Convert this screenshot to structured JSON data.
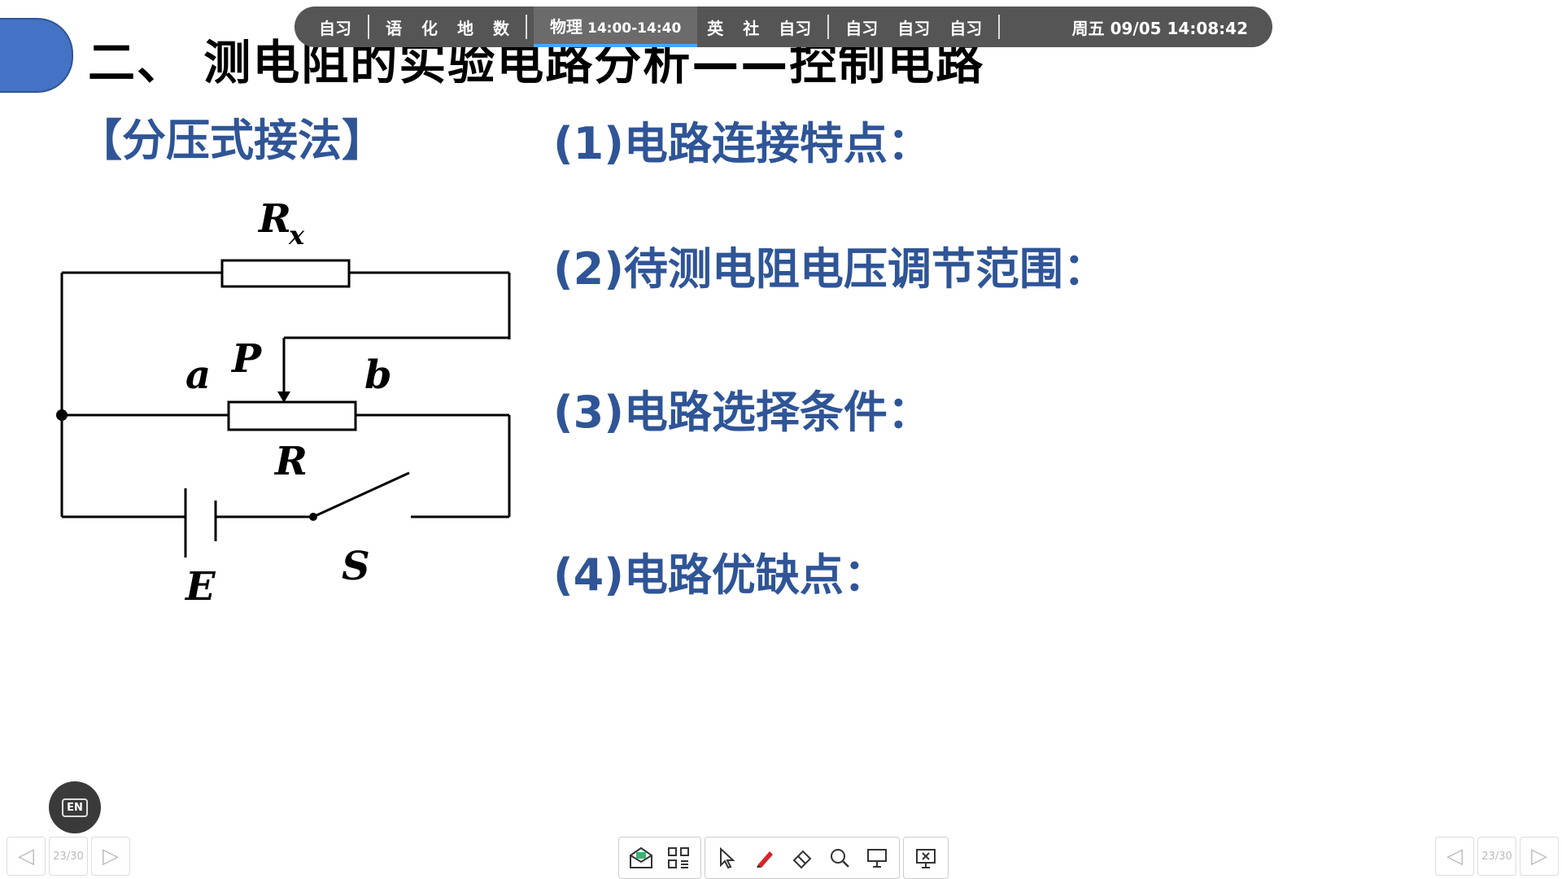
{
  "slide": {
    "title": "二、 测电阻的实验电路分析——控制电路",
    "method_label": "【分压式接法】",
    "points": [
      "(1)电路连接特点：",
      "(2)待测电阻电压调节范围：",
      "(3)电路选择条件：",
      "(4)电路优缺点："
    ],
    "circuit": {
      "rx_label": "R",
      "rx_sub": "x",
      "r_label": "R",
      "a_label": "a",
      "b_label": "b",
      "p_label": "P",
      "e_label": "E",
      "s_label": "S"
    }
  },
  "schedule": {
    "items": [
      {
        "label": "自习"
      },
      {
        "label": "语"
      },
      {
        "label": "化"
      },
      {
        "label": "地"
      },
      {
        "label": "数"
      }
    ],
    "current": {
      "label": "物理",
      "time": "14:00-14:40"
    },
    "items2": [
      {
        "label": "英"
      },
      {
        "label": "社"
      },
      {
        "label": "自习"
      }
    ],
    "items3": [
      {
        "label": "自习"
      },
      {
        "label": "自习"
      },
      {
        "label": "自习"
      }
    ],
    "clock": "周五 09/05  14:08:42"
  },
  "controls": {
    "en_label": "EN",
    "page_indicator": "23/30",
    "icons": {
      "left_prev": "chevron-left-icon",
      "left_next": "chevron-right-icon",
      "tools": [
        "envelope-icon",
        "grid-icon",
        "pointer-icon",
        "pen-icon",
        "eraser-icon",
        "magnifier-icon",
        "screen-icon",
        "exit-presentation-icon"
      ]
    },
    "colors": {
      "accent": "#4472c4",
      "text_blue": "#2f5597",
      "pen_red": "#d9242b"
    }
  }
}
